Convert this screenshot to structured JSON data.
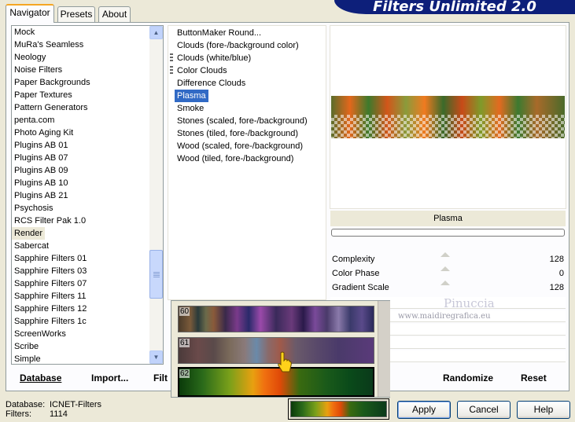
{
  "tabs": [
    {
      "label": "Navigator",
      "active": true
    },
    {
      "label": "Presets",
      "active": false
    },
    {
      "label": "About",
      "active": false
    }
  ],
  "banner_title": "Filters Unlimited 2.0",
  "categories": [
    "Mock",
    "MuRa's Seamless",
    "Neology",
    "Noise Filters",
    "Paper Backgrounds",
    "Paper Textures",
    "Pattern Generators",
    "penta.com",
    "Photo Aging Kit",
    "Plugins AB 01",
    "Plugins AB 07",
    "Plugins AB 09",
    "Plugins AB 10",
    "Plugins AB 21",
    "Psychosis",
    "RCS Filter Pak 1.0",
    "Render",
    "Sabercat",
    "Sapphire Filters 01",
    "Sapphire Filters 03",
    "Sapphire Filters 07",
    "Sapphire Filters 11",
    "Sapphire Filters 12",
    "Sapphire Filters 1c",
    "ScreenWorks",
    "Scribe",
    "Simple"
  ],
  "selected_category": "Render",
  "filters": [
    "ButtonMaker Round...",
    "Clouds (fore-/background color)",
    "Clouds (white/blue)",
    "Color Clouds",
    "Difference Clouds",
    "Plasma",
    "Smoke",
    "Stones (scaled, fore-/background)",
    "Stones (tiled, fore-/background)",
    "Wood (scaled, fore-/background)",
    "Wood (tiled, fore-/background)"
  ],
  "selected_filter": "Plasma",
  "preview": {
    "filter_name": "Plasma"
  },
  "parameters": [
    {
      "label": "Complexity",
      "value": "128"
    },
    {
      "label": "Color Phase",
      "value": "0"
    },
    {
      "label": "Gradient Scale",
      "value": "128"
    }
  ],
  "watermark": {
    "name": "Pinuccia",
    "site": "www.maidiregrafica.eu"
  },
  "gradient_picker": {
    "items": [
      {
        "number": "60"
      },
      {
        "number": "61"
      },
      {
        "number": "62"
      }
    ]
  },
  "bottom_links": {
    "database": "Database",
    "import": "Import...",
    "filter_info": "Filt",
    "randomize": "Randomize",
    "reset": "Reset"
  },
  "status": {
    "database_label": "Database:",
    "database_value": "ICNET-Filters",
    "filters_label": "Filters:",
    "filters_value": "1114"
  },
  "buttons": {
    "apply": "Apply",
    "cancel": "Cancel",
    "help": "Help"
  },
  "colors": {
    "selection": "#316ac5",
    "banner": "#0d1f7a",
    "accent_tab": "#f5a623"
  }
}
